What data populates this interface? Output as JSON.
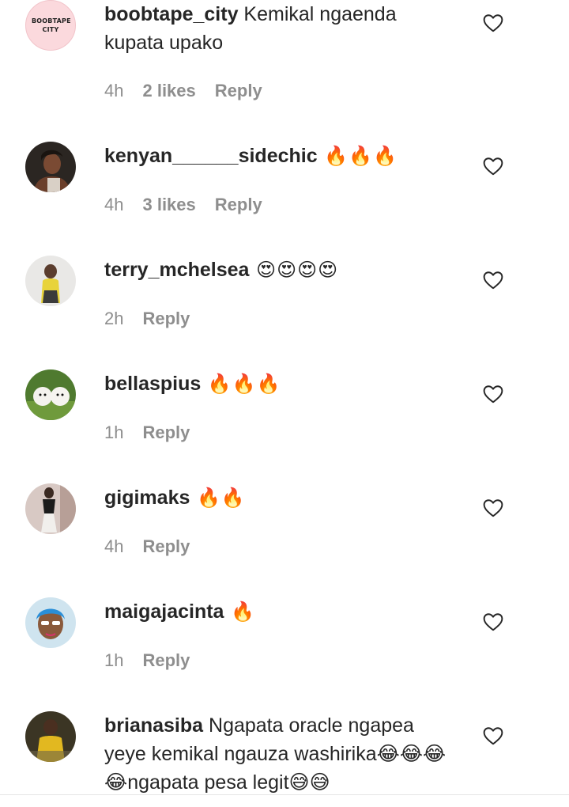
{
  "comments": [
    {
      "avatar_text": "BOOBTAPE CITY",
      "username": "boobtape_city",
      "text": " Kemikal ngaenda kupata upako",
      "emoji": "",
      "time": "4h",
      "likes": "2 likes",
      "reply": "Reply"
    },
    {
      "username": "kenyan______sidechic",
      "text": "",
      "emoji": " 🔥🔥🔥",
      "time": "4h",
      "likes": "3 likes",
      "reply": "Reply"
    },
    {
      "username": "terry_mchelsea",
      "text": "",
      "emoji": " 😍😍😍😍",
      "time": "2h",
      "likes": "",
      "reply": "Reply"
    },
    {
      "username": "bellaspius",
      "text": "",
      "emoji": " 🔥🔥🔥",
      "time": "1h",
      "likes": "",
      "reply": "Reply"
    },
    {
      "username": "gigimaks",
      "text": "",
      "emoji": " 🔥🔥",
      "time": "4h",
      "likes": "",
      "reply": "Reply"
    },
    {
      "username": "maigajacinta",
      "text": "",
      "emoji": " 🔥",
      "time": "1h",
      "likes": "",
      "reply": "Reply"
    },
    {
      "username": "brianasiba",
      "text": " Ngapata oracle ngapea yeye kemikal ngauza washirika😂😂😂😂ngapata pesa legit😅😅",
      "emoji": "",
      "time": "",
      "likes": "",
      "reply": ""
    }
  ],
  "icons": {
    "like": "heart-outline-icon",
    "avatar": "user-avatar"
  },
  "colors": {
    "text": "#262626",
    "meta": "#8e8e8e",
    "logo_avatar_bg": "#fbd9dd"
  }
}
